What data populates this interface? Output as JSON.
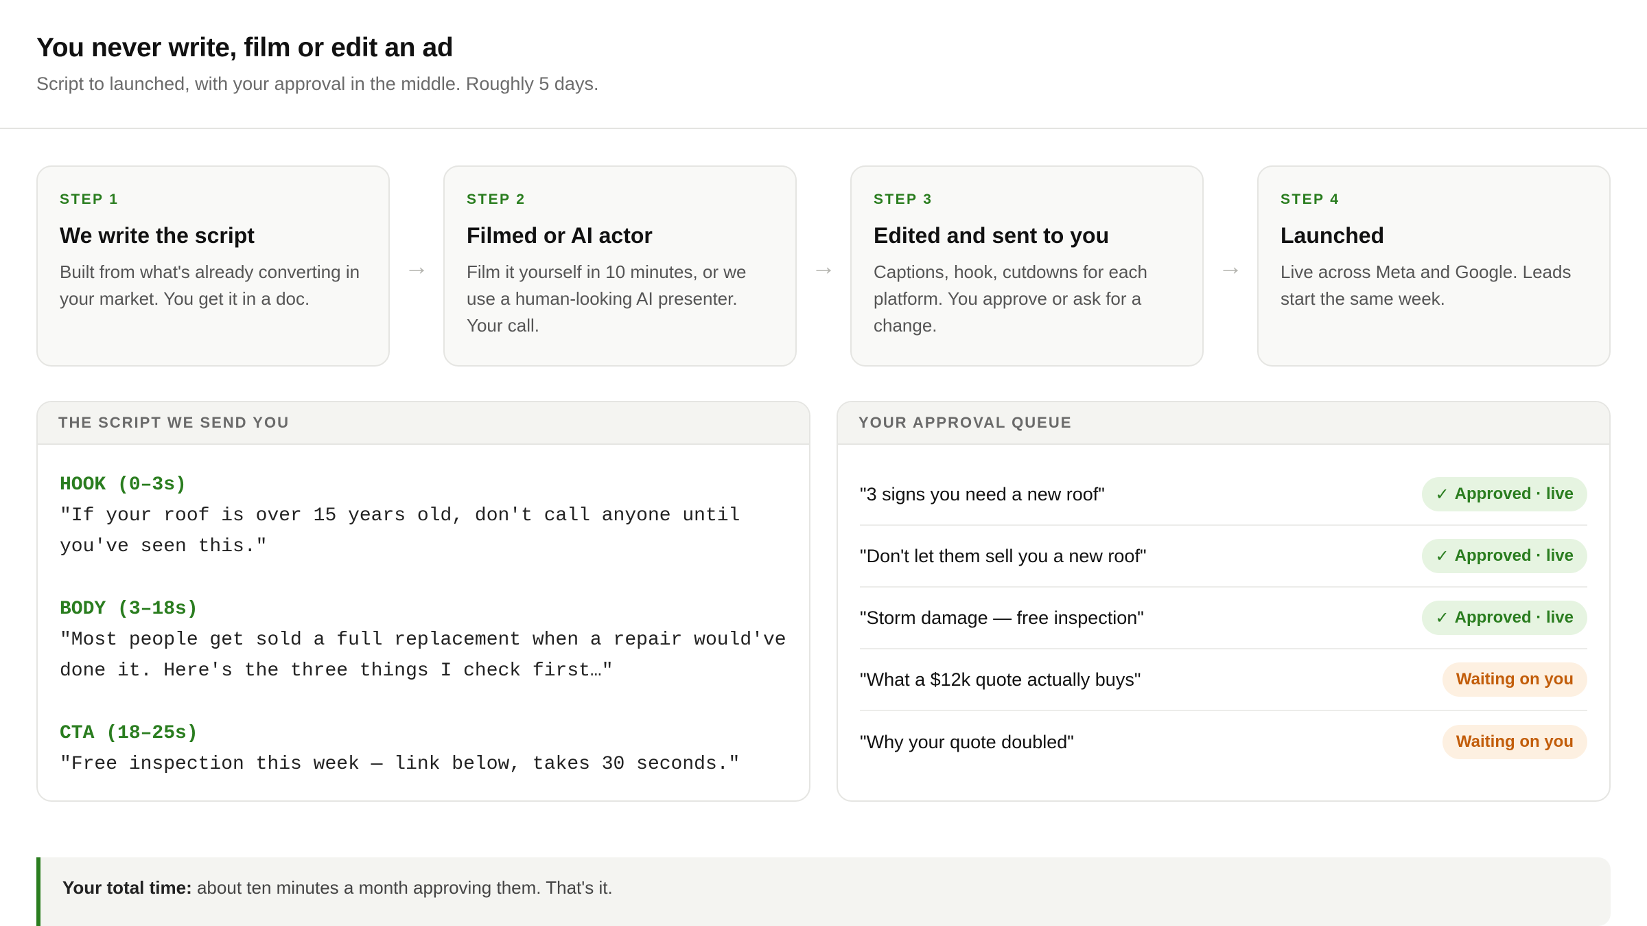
{
  "header": {
    "title": "You never write, film or edit an ad",
    "subtitle": "Script to launched, with your approval in the middle. Roughly 5 days."
  },
  "steps": [
    {
      "label": "STEP 1",
      "title": "We write the script",
      "text": "Built from what's already converting in your market. You get it in a doc."
    },
    {
      "label": "STEP 2",
      "title": "Filmed or AI actor",
      "text": "Film it yourself in 10 minutes, or we use a human-looking AI presenter. Your call."
    },
    {
      "label": "STEP 3",
      "title": "Edited and sent to you",
      "text": "Captions, hook, cutdowns for each platform. You approve or ask for a change."
    },
    {
      "label": "STEP 4",
      "title": "Launched",
      "text": "Live across Meta and Google. Leads start the same week."
    }
  ],
  "arrow_glyph": "→",
  "script_panel": {
    "heading": "THE SCRIPT WE SEND YOU",
    "sections": [
      {
        "label": "HOOK (0–3s)",
        "text": "\"If your roof is over 15 years old, don't call anyone until you've seen this.\""
      },
      {
        "label": "BODY (3–18s)",
        "text": "\"Most people get sold a full replacement when a repair would've done it. Here's the three things I check first…\""
      },
      {
        "label": "CTA (18–25s)",
        "text": "\"Free inspection this week — link below, takes 30 seconds.\""
      }
    ]
  },
  "queue_panel": {
    "heading": "YOUR APPROVAL QUEUE",
    "check_glyph": "✓",
    "items": [
      {
        "title": "\"3 signs you need a new roof\"",
        "status": "Approved · live",
        "state": "approved"
      },
      {
        "title": "\"Don't let them sell you a new roof\"",
        "status": "Approved · live",
        "state": "approved"
      },
      {
        "title": "\"Storm damage — free inspection\"",
        "status": "Approved · live",
        "state": "approved"
      },
      {
        "title": "\"What a $12k quote actually buys\"",
        "status": "Waiting on you",
        "state": "waiting"
      },
      {
        "title": "\"Why your quote doubled\"",
        "status": "Waiting on you",
        "state": "waiting"
      }
    ]
  },
  "footer": {
    "label": "Your total time:",
    "text": " about ten minutes a month approving them. That's it."
  },
  "colors": {
    "accent_green": "#2a7d1f",
    "approved_bg": "#e6f4e1",
    "waiting_text": "#c25d0a",
    "waiting_bg": "#fdf0e1"
  }
}
